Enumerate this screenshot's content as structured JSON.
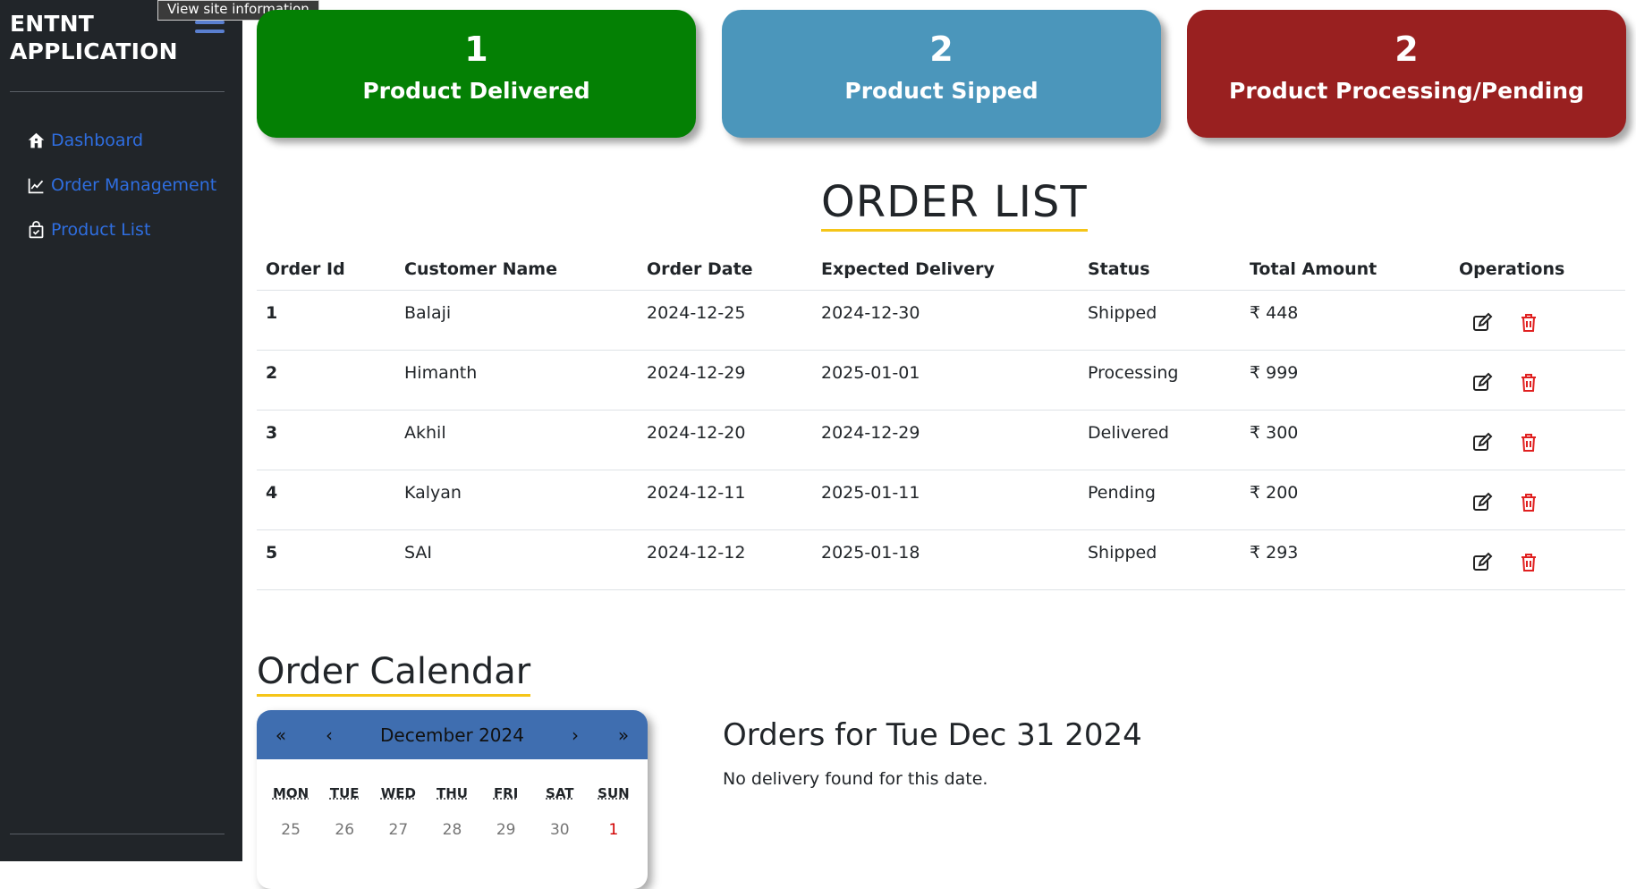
{
  "browser": {
    "tooltip": "View site information"
  },
  "sidebar": {
    "brand_line1": "ENTNT",
    "brand_line2": "APPLICATION",
    "items": [
      {
        "label": "Dashboard",
        "icon": "home-icon"
      },
      {
        "label": "Order Management",
        "icon": "chart-line-icon"
      },
      {
        "label": "Product List",
        "icon": "shopping-bag-check-icon"
      }
    ]
  },
  "stats": [
    {
      "value": "1",
      "label": "Product Delivered",
      "color": "#048004"
    },
    {
      "value": "2",
      "label": "Product Sipped",
      "color": "#4b96bb"
    },
    {
      "value": "2",
      "label": "Product Processing/Pending",
      "color": "#992020"
    }
  ],
  "order_list": {
    "title": "ORDER LIST",
    "columns": [
      "Order Id",
      "Customer Name",
      "Order Date",
      "Expected Delivery",
      "Status",
      "Total Amount",
      "Operations"
    ],
    "rows": [
      {
        "id": "1",
        "customer": "Balaji",
        "order_date": "2024-12-25",
        "expected": "2024-12-30",
        "status": "Shipped",
        "amount": "₹ 448"
      },
      {
        "id": "2",
        "customer": "Himanth",
        "order_date": "2024-12-29",
        "expected": "2025-01-01",
        "status": "Processing",
        "amount": "₹ 999"
      },
      {
        "id": "3",
        "customer": "Akhil",
        "order_date": "2024-12-20",
        "expected": "2024-12-29",
        "status": "Delivered",
        "amount": "₹ 300"
      },
      {
        "id": "4",
        "customer": "Kalyan",
        "order_date": "2024-12-11",
        "expected": "2025-01-11",
        "status": "Pending",
        "amount": "₹ 200"
      },
      {
        "id": "5",
        "customer": "SAI",
        "order_date": "2024-12-12",
        "expected": "2025-01-18",
        "status": "Shipped",
        "amount": "₹ 293"
      }
    ]
  },
  "calendar": {
    "title": "Order Calendar",
    "nav_prev_year": "«",
    "nav_prev": "‹",
    "month": "December 2024",
    "nav_next": "›",
    "nav_next_year": "»",
    "weekdays": [
      "MON",
      "TUE",
      "WED",
      "THU",
      "FRI",
      "SAT",
      "SUN"
    ],
    "first_row": [
      "25",
      "26",
      "27",
      "28",
      "29",
      "30",
      "1"
    ],
    "header_color": "#3f6eb0"
  },
  "selected_day": {
    "heading": "Orders for Tue Dec 31 2024",
    "message": "No delivery found for this date."
  },
  "colors": {
    "sidebar_bg": "#212529",
    "link": "#2f6ee0",
    "accent_underline": "#f5c518",
    "delete_icon": "#e02020"
  }
}
